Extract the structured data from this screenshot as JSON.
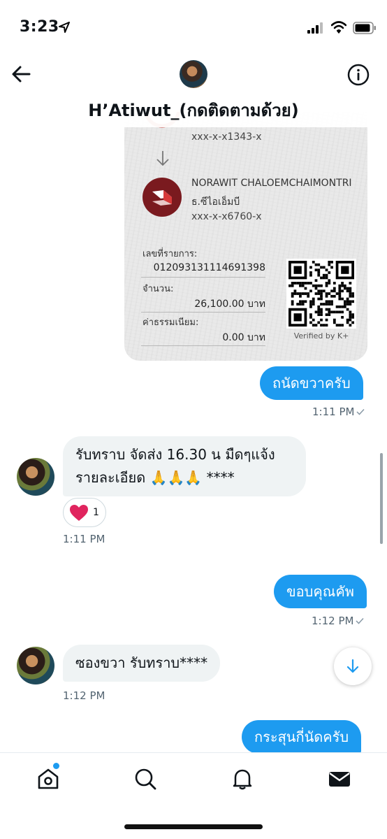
{
  "status_bar": {
    "time": "3:23"
  },
  "header": {
    "title": "H’Atiwut_(กดติดตามด้วย)"
  },
  "receipt": {
    "top_account": "xxx-x-x1343-x",
    "recipient_name": "NORAWIT CHALOEMCHAIMONTRI",
    "recipient_bank": "ธ.ซีไอเอ็มบี",
    "recipient_account": "xxx-x-x6760-x",
    "ref_label": "เลขที่รายการ:",
    "ref_value": "012093131114691398",
    "amount_label": "จำนวน:",
    "amount_value": "26,100.00 บาท",
    "fee_label": "ค่าธรรมเนียม:",
    "fee_value": "0.00 บาท",
    "verified": "Verified by K+"
  },
  "messages": [
    {
      "direction": "out",
      "text": "ถนัดขวาครับ",
      "time": "1:11 PM"
    },
    {
      "direction": "in",
      "line1": "รับทราบ จัดส่ง 16.30 น มืดๆแจ้ง",
      "line2": "รายละเอียด 🙏🙏🙏 ****",
      "reaction_count": "1",
      "time": "1:11 PM"
    },
    {
      "direction": "out",
      "text": "ขอบคุณคัพ",
      "time": "1:12 PM"
    },
    {
      "direction": "in",
      "text": "ซองขวา รับทราบ****",
      "time": "1:12 PM"
    },
    {
      "direction": "out",
      "text": "กระสุนกี่นัดครับ"
    }
  ],
  "bottom_nav": [
    "home-icon",
    "search-icon",
    "bell-icon",
    "mail-icon"
  ],
  "colors": {
    "accent": "#1d9bf0",
    "heart": "#e0245e",
    "bubble_in": "#eff3f4"
  }
}
